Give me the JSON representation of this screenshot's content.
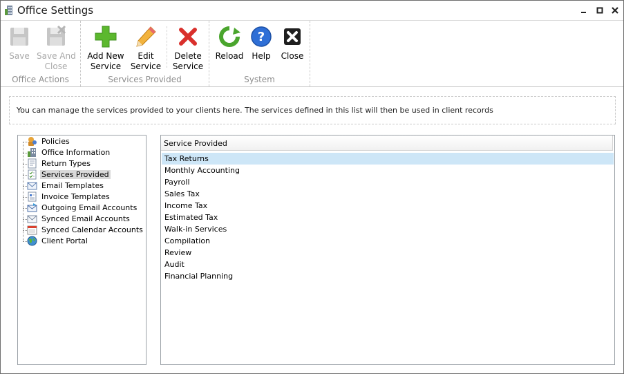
{
  "window": {
    "title": "Office Settings",
    "minimize": "▁",
    "maximize": "▢",
    "close": "✕"
  },
  "ribbon": {
    "groups": [
      {
        "label": "Office Actions",
        "buttons": [
          {
            "label1": "Save",
            "label2": ""
          },
          {
            "label1": "Save And",
            "label2": "Close"
          }
        ]
      },
      {
        "label": "Services Provided",
        "buttons": [
          {
            "label1": "Add New",
            "label2": "Service"
          },
          {
            "label1": "Edit",
            "label2": "Service"
          },
          {
            "label1": "Delete",
            "label2": "Service"
          }
        ]
      },
      {
        "label": "System",
        "buttons": [
          {
            "label1": "Reload",
            "label2": ""
          },
          {
            "label1": "Help",
            "label2": ""
          },
          {
            "label1": "Close",
            "label2": ""
          }
        ]
      }
    ]
  },
  "info": {
    "text": "You can manage the services provided to your clients here. The services defined in this list will then be used in client records"
  },
  "tree": {
    "items": [
      {
        "label": "Policies",
        "icon": "policies-icon"
      },
      {
        "label": "Office Information",
        "icon": "building-icon"
      },
      {
        "label": "Return Types",
        "icon": "document-icon"
      },
      {
        "label": "Services Provided",
        "icon": "checklist-icon"
      },
      {
        "label": "Email Templates",
        "icon": "email-template-icon"
      },
      {
        "label": "Invoice Templates",
        "icon": "invoice-icon"
      },
      {
        "label": "Outgoing Email Accounts",
        "icon": "outgoing-email-icon"
      },
      {
        "label": "Synced Email Accounts",
        "icon": "synced-email-icon"
      },
      {
        "label": "Synced Calendar Accounts",
        "icon": "calendar-icon"
      },
      {
        "label": "Client Portal",
        "icon": "globe-icon"
      }
    ],
    "selected_index": 3
  },
  "list": {
    "header": "Service Provided",
    "rows": [
      "Tax Returns",
      "Monthly Accounting",
      "Payroll",
      "Sales Tax",
      "Income Tax",
      "Estimated Tax",
      "Walk-in Services",
      "Compilation",
      "Review",
      "Audit",
      "Financial Planning"
    ],
    "selected_index": 0
  },
  "colors": {
    "accent_green": "#5cb82e",
    "delete_red": "#d9302c",
    "help_blue": "#2f6fd6",
    "selection_blue": "#cde6f7"
  }
}
